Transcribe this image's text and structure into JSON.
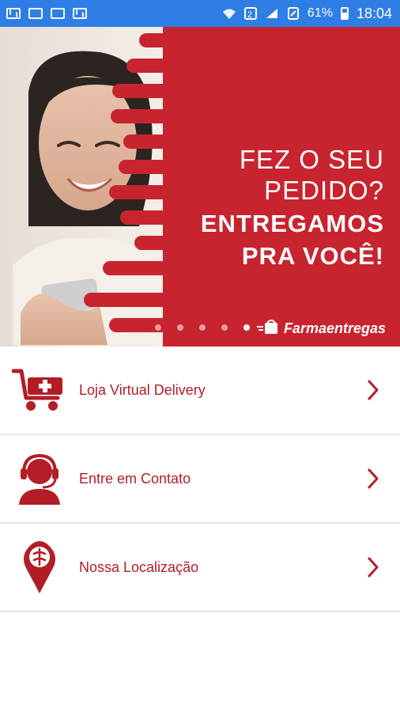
{
  "status": {
    "battery": "61%",
    "time": "18:04",
    "left_icons": [
      "mail-icon",
      "calendar-icon",
      "image-icon",
      "envelope-icon"
    ],
    "right_icons": [
      "wifi-icon",
      "sim-2-icon",
      "signal-icon",
      "sd-card-icon",
      "battery-icon"
    ]
  },
  "banner": {
    "line1": "FEZ O SEU",
    "line2": "PEDIDO?",
    "line3": "ENTREGAMOS",
    "line4": "PRA VOCÊ!",
    "brand": "Farmaentregas"
  },
  "menu": [
    {
      "label": "Loja Virtual Delivery",
      "icon": "cart-plus-icon"
    },
    {
      "label": "Entre em Contato",
      "icon": "headset-person-icon"
    },
    {
      "label": "Nossa Localização",
      "icon": "location-pin-icon"
    }
  ],
  "colors": {
    "brand_red": "#c8242f",
    "text_red": "#b21d27",
    "statusbar": "#2f7ee6"
  }
}
